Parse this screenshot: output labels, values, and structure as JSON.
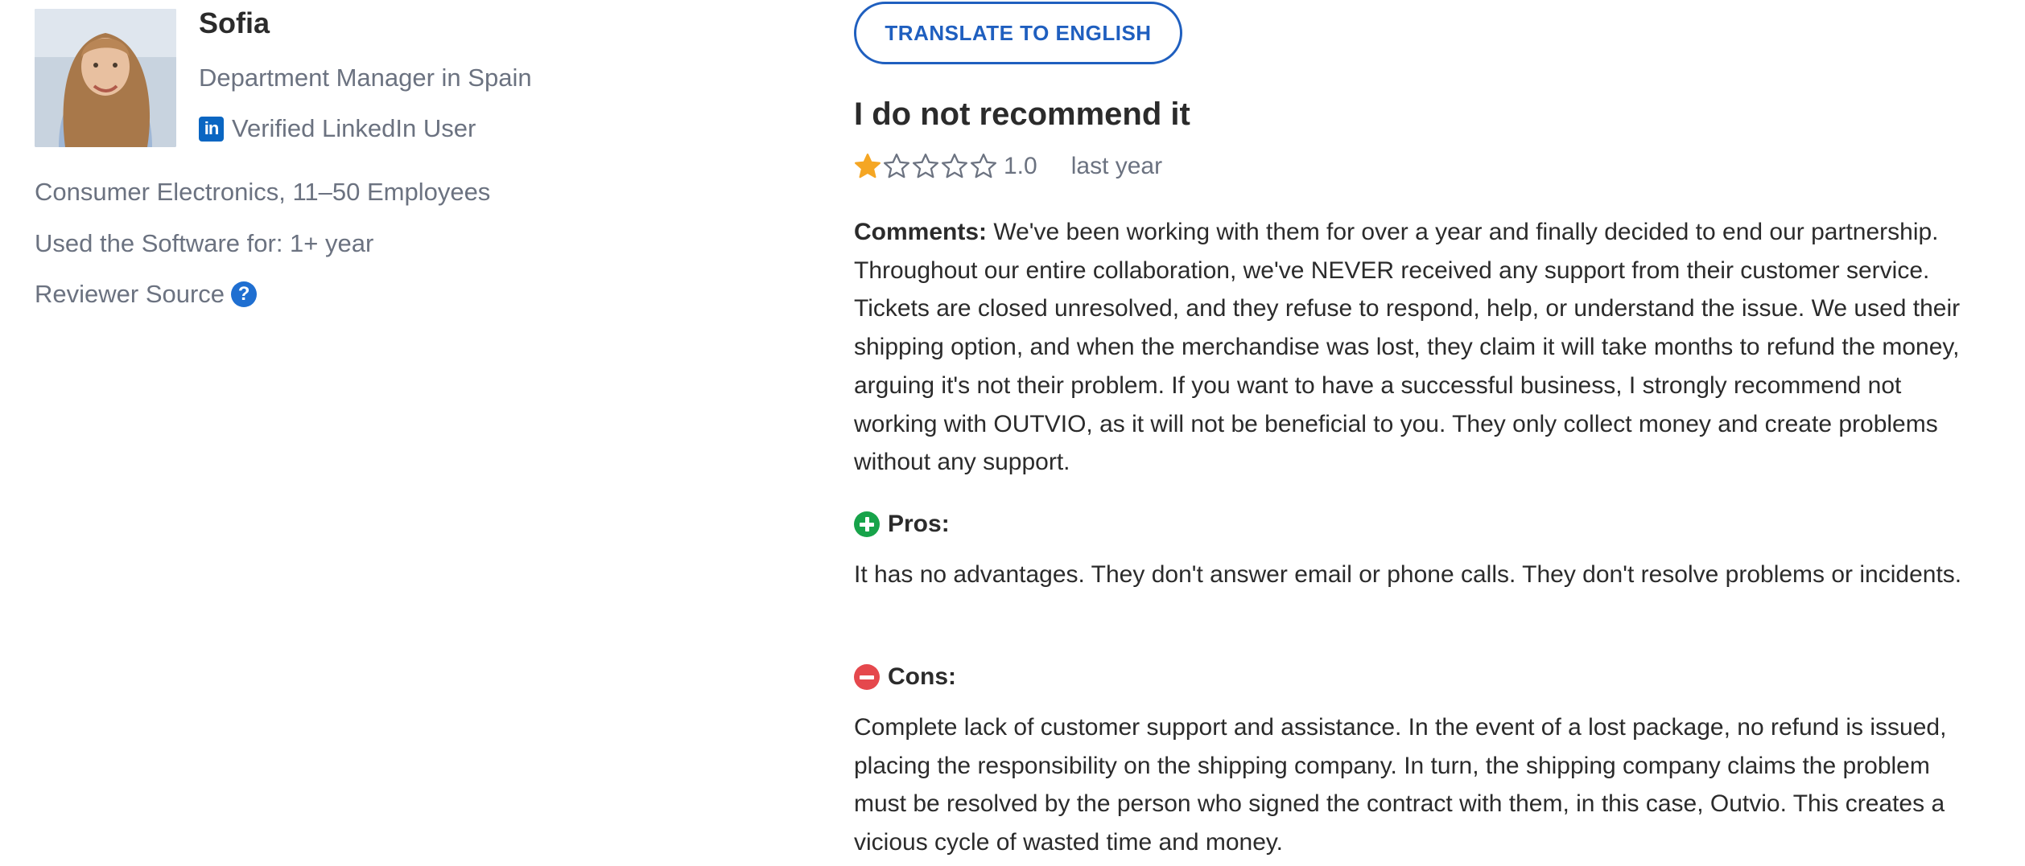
{
  "reviewer": {
    "name": "Sofia",
    "title": "Department Manager in Spain",
    "verified_label": "Verified LinkedIn User",
    "linkedin_icon_text": "in",
    "company": "Consumer Electronics, 11–50 Employees",
    "usage": "Used the Software for: 1+ year",
    "source_label": "Reviewer Source",
    "source_help_icon": "?"
  },
  "review": {
    "translate_button": "TRANSLATE TO ENGLISH",
    "title": "I do not recommend it",
    "rating": {
      "value": "1.0",
      "max_stars": 5,
      "filled_stars": 1,
      "filled_color": "#f5a623"
    },
    "date": "last year",
    "comments_label": "Comments:",
    "comments_text": " We've been working with them for over a year and finally decided to end our partnership. Throughout our entire collaboration, we've NEVER received any support from their customer service. Tickets are closed unresolved, and they refuse to respond, help, or understand the issue. We used their shipping option, and when the merchandise was lost, they claim it will take months to refund the money, arguing it's not their problem. If you want to have a successful business, I strongly recommend not working with OUTVIO, as it will not be beneficial to you. They only collect money and create problems without any support.",
    "pros_label": "Pros:",
    "pros_text": "It has no advantages. They don't answer email or phone calls. They don't resolve problems or incidents.",
    "cons_label": "Cons:",
    "cons_text": "Complete lack of customer support and assistance. In the event of a lost package, no refund is issued, placing the responsibility on the shipping company. In turn, the shipping company claims the problem must be resolved by the person who signed the contract with them, in this case, Outvio. This creates a vicious cycle of wasted time and money."
  },
  "colors": {
    "accent_blue": "#1f5fbf",
    "linkedin_blue": "#0a66c2",
    "pros_green": "#17a34a",
    "cons_red": "#e5484d",
    "muted_text": "#6b7280"
  }
}
